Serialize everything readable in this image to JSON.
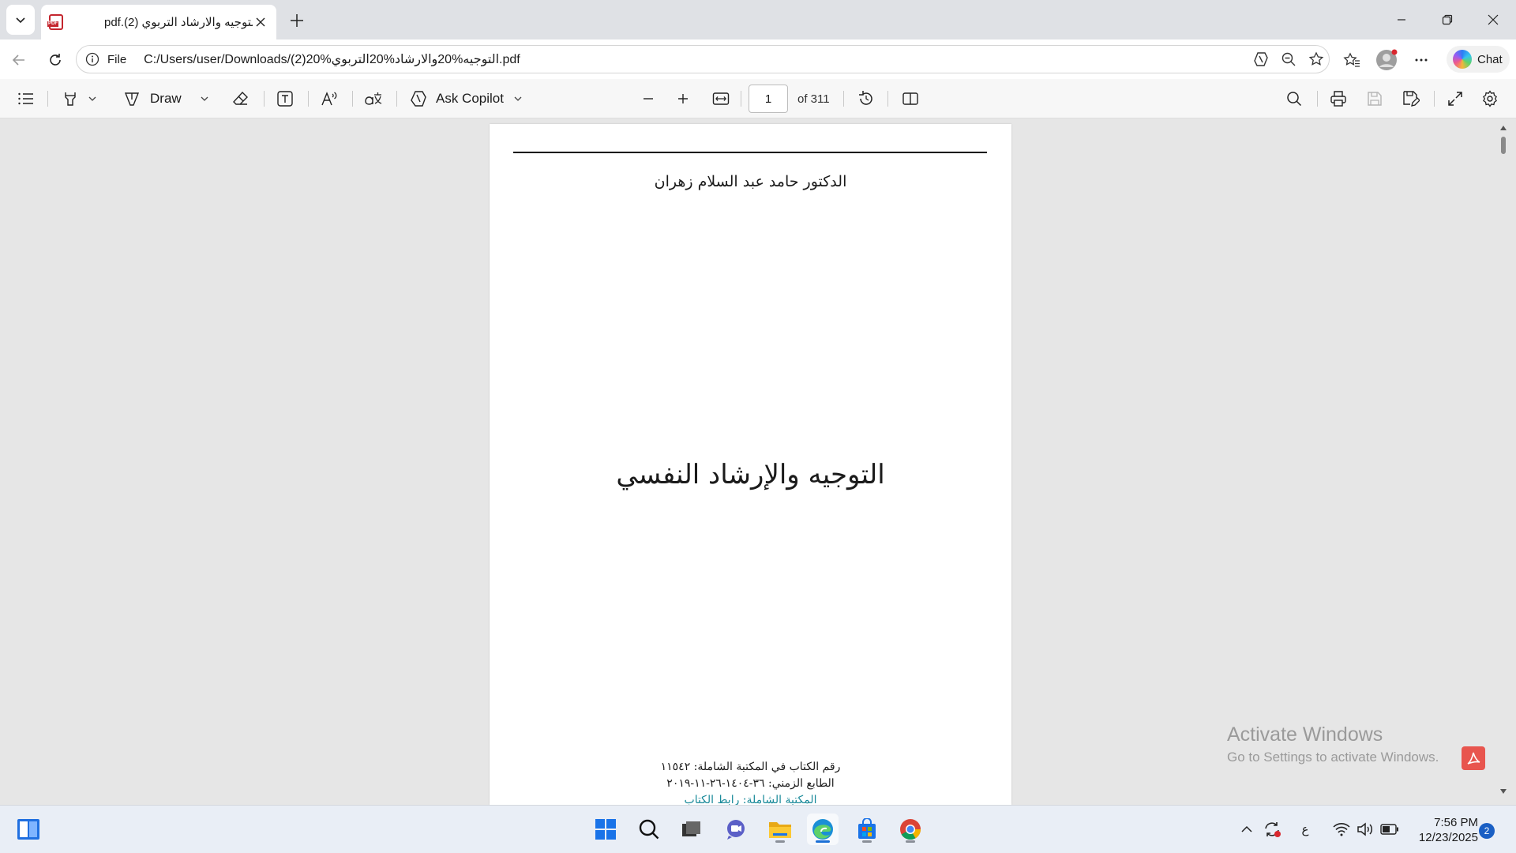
{
  "browser": {
    "tab": {
      "title": "pdf.(2) التوجيه والارشاد التربوي",
      "icon": "pdf-file-icon",
      "pdf_badge": "PDF"
    },
    "address": {
      "scheme_label": "File",
      "url": "C:/Users/user/Downloads/التوجيه%20والارشاد%20التربوي%20(2).pdf"
    },
    "chat_label": "Chat"
  },
  "pdf_toolbar": {
    "draw_label": "Draw",
    "ask_copilot_label": "Ask Copilot",
    "current_page": "1",
    "page_count_label": "of 311"
  },
  "document": {
    "author": "الدكتور حامد عبد السلام زهران",
    "title": "التوجيه والإرشاد النفسي",
    "meta_lines": [
      "رقم الكتاب في المكتبة الشاملة: ١١٥٤٢",
      "الطابع الزمني: ٣٦-١٤٠٤-٢٦-١١-٢٠١٩",
      "المكتبة الشاملة: رابط الكتاب"
    ]
  },
  "watermark": {
    "line1": "Activate Windows",
    "line2": "Go to Settings to activate Windows."
  },
  "taskbar": {
    "language_indicator": "ع",
    "time": "7:56 PM",
    "date": "12/23/2025",
    "notification_count": "2"
  },
  "colors": {
    "accent": "#1a6fd6",
    "pdf_red": "#c4262e",
    "link_teal": "#1a8a9a"
  }
}
